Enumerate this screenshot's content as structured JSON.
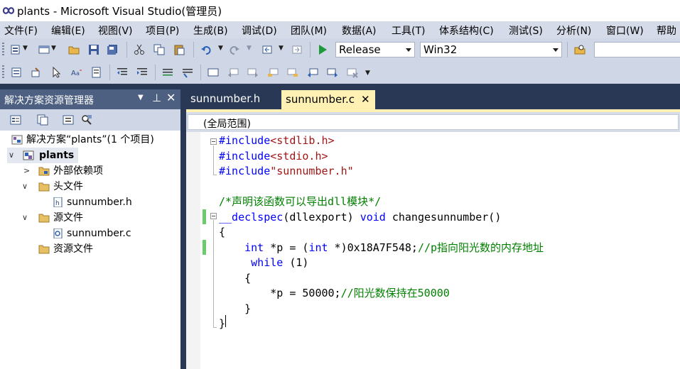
{
  "window": {
    "title": "plants - Microsoft Visual Studio(管理员)"
  },
  "menu": [
    "文件(F)",
    "编辑(E)",
    "视图(V)",
    "项目(P)",
    "生成(B)",
    "调试(D)",
    "团队(M)",
    "数据(A)",
    "工具(T)",
    "体系结构(C)",
    "测试(S)",
    "分析(N)",
    "窗口(W)",
    "帮助"
  ],
  "toolbar": {
    "config": "Release",
    "platform": "Win32",
    "search_value": ""
  },
  "solution_explorer": {
    "title": "解决方案资源管理器",
    "items": [
      {
        "label": "解决方案“plants”(1 个项目)"
      },
      {
        "label": "plants"
      },
      {
        "label": "外部依赖项"
      },
      {
        "label": "头文件"
      },
      {
        "label": "sunnumber.h"
      },
      {
        "label": "源文件"
      },
      {
        "label": "sunnumber.c"
      },
      {
        "label": "资源文件"
      }
    ]
  },
  "tabs": [
    {
      "label": "sunnumber.h",
      "active": false
    },
    {
      "label": "sunnumber.c",
      "active": true
    }
  ],
  "editor": {
    "scope": "(全局范围)",
    "lines": [
      {
        "parts": [
          {
            "t": "#include",
            "c": "pp"
          },
          {
            "t": "<stdlib.h>",
            "c": "str"
          }
        ]
      },
      {
        "parts": [
          {
            "t": "#include",
            "c": "pp"
          },
          {
            "t": "<stdio.h>",
            "c": "str"
          }
        ]
      },
      {
        "parts": [
          {
            "t": "#include",
            "c": "pp"
          },
          {
            "t": "\"sunnumber.h\"",
            "c": "str"
          }
        ]
      },
      {
        "parts": []
      },
      {
        "parts": [
          {
            "t": "/*声明该函数可以导出dll模块*/",
            "c": "cm"
          }
        ]
      },
      {
        "parts": [
          {
            "t": "__declspec",
            "c": "kw"
          },
          {
            "t": "(dllexport) ",
            "c": "txt"
          },
          {
            "t": "void",
            "c": "kw"
          },
          {
            "t": " changesunnumber()",
            "c": "txt"
          }
        ]
      },
      {
        "parts": [
          {
            "t": "{",
            "c": "txt"
          }
        ]
      },
      {
        "parts": [
          {
            "t": "    ",
            "c": "txt"
          },
          {
            "t": "int",
            "c": "kw"
          },
          {
            "t": " *p = (",
            "c": "txt"
          },
          {
            "t": "int",
            "c": "kw"
          },
          {
            "t": " *)0x18A7F548;",
            "c": "txt"
          },
          {
            "t": "//p指向阳光数的内存地址",
            "c": "cm"
          }
        ]
      },
      {
        "parts": [
          {
            "t": "     ",
            "c": "txt"
          },
          {
            "t": "while",
            "c": "kw"
          },
          {
            "t": " (1)",
            "c": "txt"
          }
        ]
      },
      {
        "parts": [
          {
            "t": "    {",
            "c": "txt"
          }
        ]
      },
      {
        "parts": [
          {
            "t": "        *p = 50000;",
            "c": "txt"
          },
          {
            "t": "//阳光数保持在50000",
            "c": "cm"
          }
        ]
      },
      {
        "parts": [
          {
            "t": "    }",
            "c": "txt"
          }
        ]
      },
      {
        "parts": [
          {
            "t": "}",
            "c": "txt"
          }
        ]
      }
    ]
  },
  "colors": {
    "titlebar_bg": "#ffffff",
    "menu_bg": "#d6dbe9",
    "toolbar_bg": "#cfd6e5",
    "panel_header": "#4d6082",
    "dark_band": "#293955",
    "active_tab": "#fff0b3",
    "keyword": "#0000ff",
    "string": "#a31515",
    "comment": "#008000"
  }
}
